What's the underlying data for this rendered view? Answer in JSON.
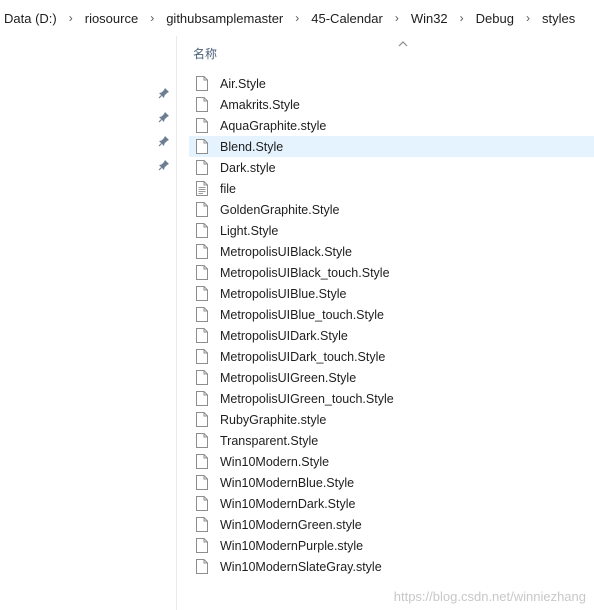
{
  "breadcrumb": [
    "Data (D:)",
    "riosource",
    "githubsamplemaster",
    "45-Calendar",
    "Win32",
    "Debug",
    "styles"
  ],
  "list": {
    "column_header": "名称",
    "selected_index": 3,
    "files": [
      {
        "name": "Air.Style",
        "icon": "file-icon"
      },
      {
        "name": "Amakrits.Style",
        "icon": "file-icon"
      },
      {
        "name": "AquaGraphite.style",
        "icon": "file-icon"
      },
      {
        "name": "Blend.Style",
        "icon": "file-icon"
      },
      {
        "name": "Dark.style",
        "icon": "file-icon"
      },
      {
        "name": "file",
        "icon": "text-file-icon"
      },
      {
        "name": "GoldenGraphite.Style",
        "icon": "file-icon"
      },
      {
        "name": "Light.Style",
        "icon": "file-icon"
      },
      {
        "name": "MetropolisUIBlack.Style",
        "icon": "file-icon"
      },
      {
        "name": "MetropolisUIBlack_touch.Style",
        "icon": "file-icon"
      },
      {
        "name": "MetropolisUIBlue.Style",
        "icon": "file-icon"
      },
      {
        "name": "MetropolisUIBlue_touch.Style",
        "icon": "file-icon"
      },
      {
        "name": "MetropolisUIDark.Style",
        "icon": "file-icon"
      },
      {
        "name": "MetropolisUIDark_touch.Style",
        "icon": "file-icon"
      },
      {
        "name": "MetropolisUIGreen.Style",
        "icon": "file-icon"
      },
      {
        "name": "MetropolisUIGreen_touch.Style",
        "icon": "file-icon"
      },
      {
        "name": "RubyGraphite.style",
        "icon": "file-icon"
      },
      {
        "name": "Transparent.Style",
        "icon": "file-icon"
      },
      {
        "name": "Win10Modern.Style",
        "icon": "file-icon"
      },
      {
        "name": "Win10ModernBlue.Style",
        "icon": "file-icon"
      },
      {
        "name": "Win10ModernDark.Style",
        "icon": "file-icon"
      },
      {
        "name": "Win10ModernGreen.style",
        "icon": "file-icon"
      },
      {
        "name": "Win10ModernPurple.style",
        "icon": "file-icon"
      },
      {
        "name": "Win10ModernSlateGray.style",
        "icon": "file-icon"
      }
    ]
  },
  "pins": [
    "pin-icon",
    "pin-icon",
    "pin-icon",
    "pin-icon"
  ],
  "watermark": "https://blog.csdn.net/winniezhang",
  "colors": {
    "selected_row": "#e5f3ff",
    "header_text": "#4c607a",
    "pin": "#6d7d92"
  }
}
